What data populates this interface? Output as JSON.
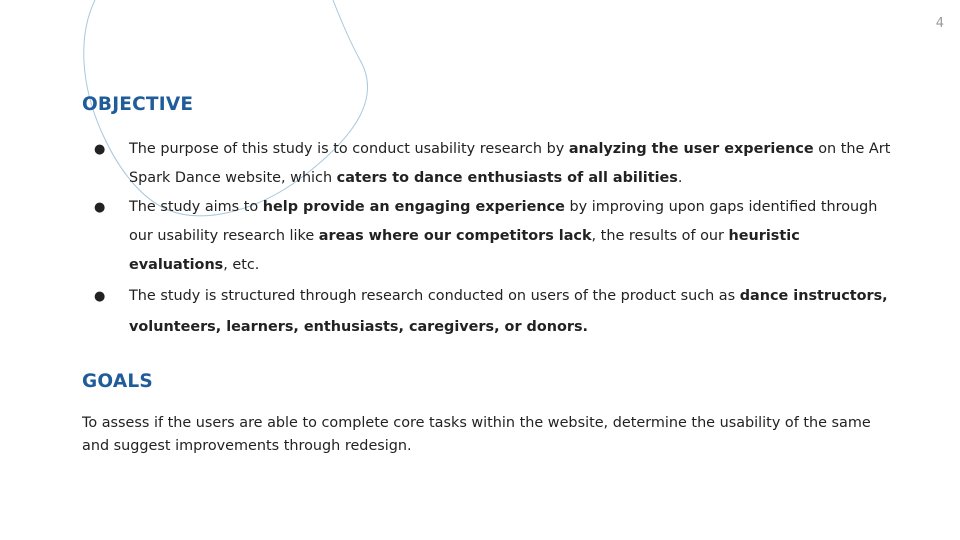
{
  "page_number": "4",
  "colors": {
    "heading": "#1f5c99",
    "body_text": "#222222",
    "decor_line": "#a9c8dc",
    "page_number": "#9a9a9a"
  },
  "objective": {
    "heading": "OBJECTIVE",
    "bullets": [
      [
        {
          "t": "The purpose of this study is to conduct usability research by ",
          "b": false
        },
        {
          "t": "analyzing the user experience",
          "b": true
        },
        {
          "t": " on the Art Spark Dance website, which ",
          "b": false
        },
        {
          "t": "caters to dance enthusiasts of all abilities",
          "b": true
        },
        {
          "t": ".",
          "b": false
        }
      ],
      [
        {
          "t": "The study aims to ",
          "b": false
        },
        {
          "t": "help provide an engaging experience",
          "b": true
        },
        {
          "t": " by improving upon gaps identified through our usability research like ",
          "b": false
        },
        {
          "t": "areas where our competitors lack",
          "b": true
        },
        {
          "t": ", the results of our ",
          "b": false
        },
        {
          "t": "heuristic evaluations",
          "b": true
        },
        {
          "t": ", etc.",
          "b": false
        }
      ],
      [
        {
          "t": "The study is structured through research conducted on users of the product such as ",
          "b": false
        },
        {
          "t": "dance instructors, volunteers, learners, enthusiasts, caregivers, or donors.",
          "b": true
        }
      ]
    ]
  },
  "goals": {
    "heading": "GOALS",
    "text": "To assess if the users are able to complete core tasks within the website, determine the usability of the same and suggest improvements through redesign."
  }
}
